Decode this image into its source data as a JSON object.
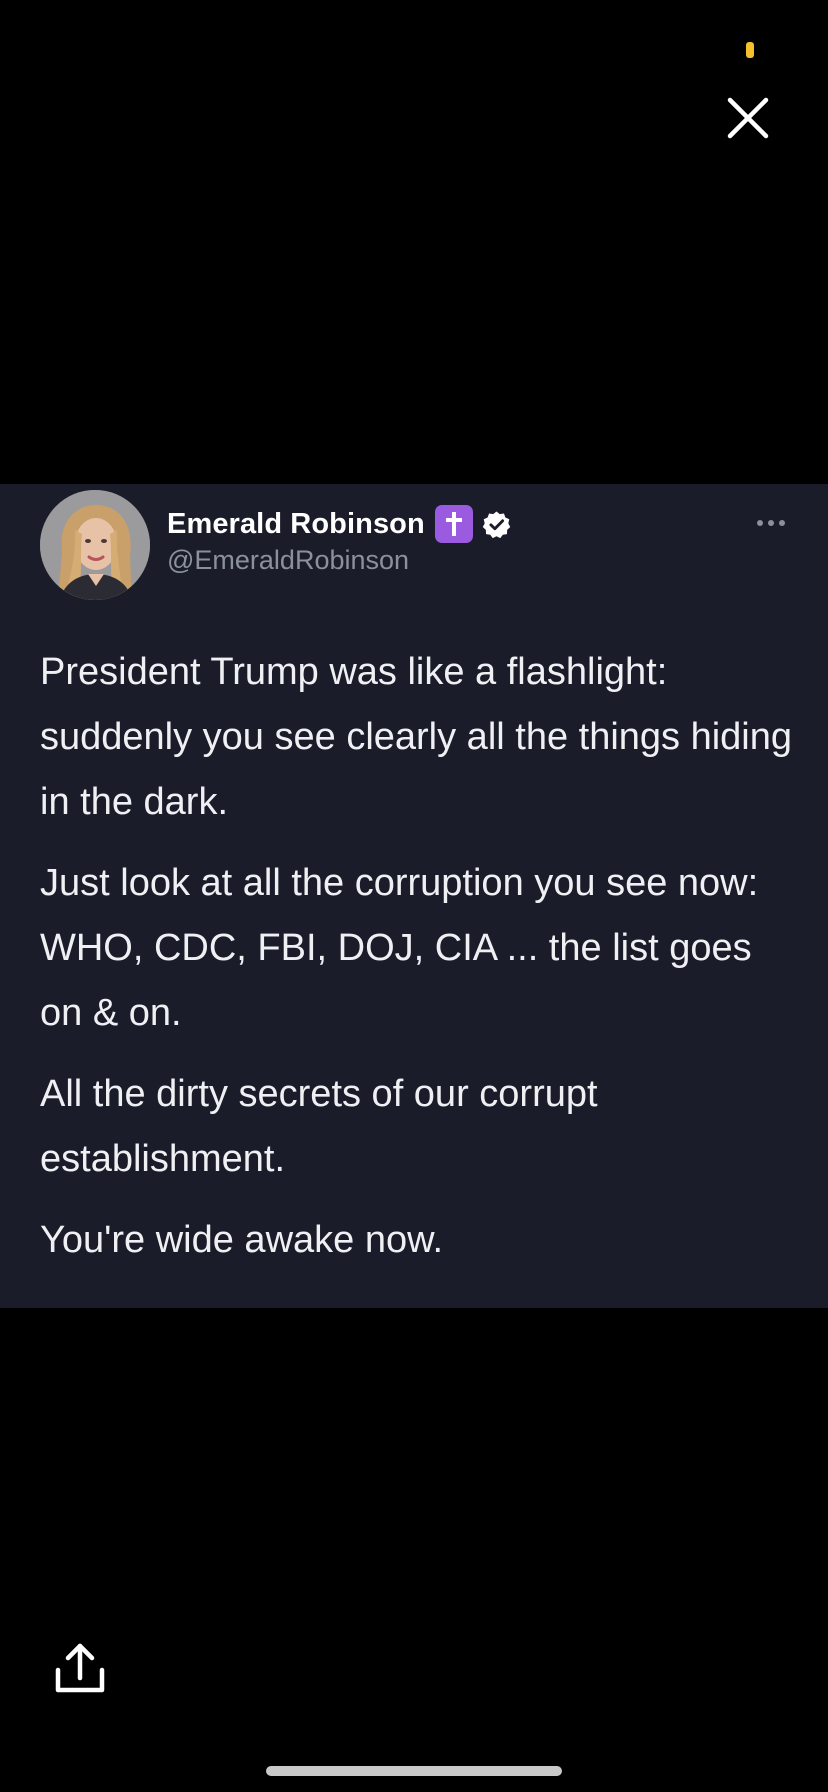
{
  "viewer": {
    "close_icon": "close-icon",
    "share_icon": "share-icon"
  },
  "tweet": {
    "author": {
      "display_name": "Emerald Robinson",
      "handle": "@EmeraldRobinson",
      "badges": [
        "latin-cross-emoji",
        "verified-check-icon"
      ]
    },
    "more_icon": "more-horizontal-icon",
    "paragraphs": [
      "President Trump was like a flashlight: suddenly you see clearly all the things hiding in the dark.",
      "Just look at all the corruption you see now: WHO, CDC, FBI, DOJ, CIA ... the list goes on & on.",
      "All the dirty secrets of our corrupt establishment.",
      "You're wide awake now."
    ]
  },
  "colors": {
    "background": "#000000",
    "card_background": "#1a1d29",
    "handle_text": "#8b919c",
    "cross_badge": "#9a5be0",
    "status_indicator": "#f5c02d"
  }
}
